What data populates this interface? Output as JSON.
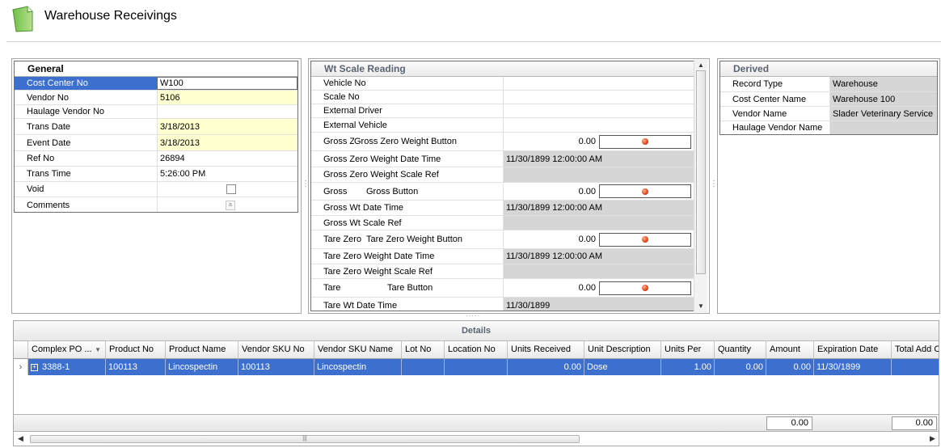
{
  "page": {
    "title": "Warehouse Receivings"
  },
  "general": {
    "header": "General",
    "rows": [
      {
        "label": "Cost Center No",
        "value": "W100"
      },
      {
        "label": "Vendor No",
        "value": "5106"
      },
      {
        "label": "Haulage Vendor No",
        "value": ""
      },
      {
        "label": "Trans Date",
        "value": "3/18/2013"
      },
      {
        "label": "Event Date",
        "value": "3/18/2013"
      },
      {
        "label": "Ref No",
        "value": "26894"
      },
      {
        "label": "Trans Time",
        "value": "5:26:00 PM"
      },
      {
        "label": "Void",
        "value": ""
      },
      {
        "label": "Comments",
        "value": ""
      }
    ]
  },
  "wt_scale": {
    "header": "Wt Scale Reading",
    "rows": [
      {
        "label": "Vehicle No",
        "value": ""
      },
      {
        "label": "Scale No",
        "value": ""
      },
      {
        "label": "External Driver",
        "value": ""
      },
      {
        "label": "External Vehicle",
        "value": ""
      },
      {
        "label": "Gross Zer",
        "button_label": "Gross Zero Weight Button",
        "value": "0.00"
      },
      {
        "label": "Gross Zero Weight Date Time",
        "value": "11/30/1899 12:00:00 AM"
      },
      {
        "label": "Gross Zero Weight Scale Ref",
        "value": ""
      },
      {
        "label": "Gross",
        "button_label": "Gross Button",
        "value": "0.00"
      },
      {
        "label": "Gross Wt Date Time",
        "value": "11/30/1899 12:00:00 AM"
      },
      {
        "label": "Gross Wt Scale Ref",
        "value": ""
      },
      {
        "label": "Tare Zero",
        "button_label": "Tare Zero Weight Button",
        "value": "0.00"
      },
      {
        "label": "Tare Zero Weight Date Time",
        "value": "11/30/1899 12:00:00 AM"
      },
      {
        "label": "Tare Zero Weight Scale Ref",
        "value": ""
      },
      {
        "label": "Tare",
        "button_label": "Tare Button",
        "value": "0.00"
      },
      {
        "label": "Tare Wt Date Time",
        "value": "11/30/1899"
      }
    ]
  },
  "derived": {
    "header": "Derived",
    "rows": [
      {
        "label": "Record Type",
        "value": "Warehouse"
      },
      {
        "label": "Cost Center Name",
        "value": "Warehouse 100"
      },
      {
        "label": "Vendor Name",
        "value": "Slader Veterinary Service"
      },
      {
        "label": "Haulage Vendor Name",
        "value": ""
      }
    ]
  },
  "details": {
    "title": "Details",
    "columns": [
      "Complex PO ...",
      "Product No",
      "Product Name",
      "Vendor SKU No",
      "Vendor SKU Name",
      "Lot No",
      "Location No",
      "Units Received",
      "Unit Description",
      "Units Per",
      "Quantity",
      "Amount",
      "Expiration Date",
      "Total Add C"
    ],
    "rows": [
      [
        "3388-1",
        "100113",
        "Lincospectin",
        "100113",
        "Lincospectin",
        "",
        "",
        "0.00",
        "Dose",
        "1.00",
        "0.00",
        "0.00",
        "11/30/1899",
        ""
      ]
    ],
    "summary": {
      "amount_total": "0.00",
      "total_add": "0.00"
    }
  },
  "colors": {
    "selection": "#3c6fce",
    "required_field": "#ffffd0",
    "readonly_field": "#d6d6d6",
    "indicator": "#e0441c"
  },
  "icons": {
    "title": "document-icon",
    "button": "red-dot-icon"
  }
}
